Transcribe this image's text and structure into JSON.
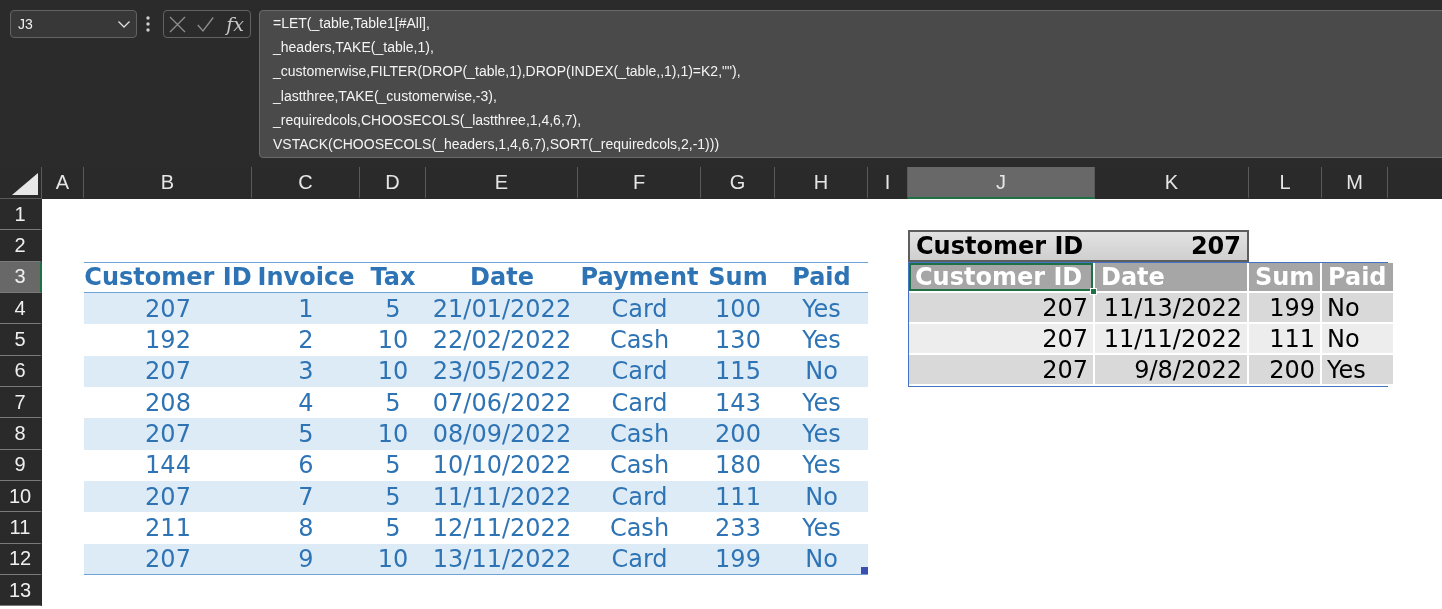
{
  "formula_bar": {
    "name_box": "J3",
    "function_label": "fx",
    "formula_lines": [
      "=LET(_table,Table1[#All],",
      "_headers,TAKE(_table,1),",
      "_customerwise,FILTER(DROP(_table,1),DROP(INDEX(_table,,1),1)=K2,\"\"),",
      "_lastthree,TAKE(_customerwise,-3),",
      "_requiredcols,CHOOSECOLS(_lastthree,1,4,6,7),",
      "VSTACK(CHOOSECOLS(_headers,1,4,6,7),SORT(_requiredcols,2,-1)))"
    ]
  },
  "column_headers": [
    {
      "label": "A",
      "selected": false
    },
    {
      "label": "B",
      "selected": false
    },
    {
      "label": "C",
      "selected": false
    },
    {
      "label": "D",
      "selected": false
    },
    {
      "label": "E",
      "selected": false
    },
    {
      "label": "F",
      "selected": false
    },
    {
      "label": "G",
      "selected": false
    },
    {
      "label": "H",
      "selected": false
    },
    {
      "label": "I",
      "selected": false
    },
    {
      "label": "J",
      "selected": true
    },
    {
      "label": "K",
      "selected": false
    },
    {
      "label": "L",
      "selected": false
    },
    {
      "label": "M",
      "selected": false
    }
  ],
  "row_headers": [
    {
      "label": "1",
      "selected": false
    },
    {
      "label": "2",
      "selected": false
    },
    {
      "label": "3",
      "selected": true
    },
    {
      "label": "4",
      "selected": false
    },
    {
      "label": "5",
      "selected": false
    },
    {
      "label": "6",
      "selected": false
    },
    {
      "label": "7",
      "selected": false
    },
    {
      "label": "8",
      "selected": false
    },
    {
      "label": "9",
      "selected": false
    },
    {
      "label": "10",
      "selected": false
    },
    {
      "label": "11",
      "selected": false
    },
    {
      "label": "12",
      "selected": false
    },
    {
      "label": "13",
      "selected": false
    }
  ],
  "sales_table": {
    "columns": [
      "Customer ID",
      "Invoice",
      "Tax",
      "Date",
      "Payment",
      "Sum",
      "Paid"
    ],
    "rows": [
      [
        "207",
        "1",
        "5",
        "21/01/2022",
        "Card",
        "100",
        "Yes"
      ],
      [
        "192",
        "2",
        "10",
        "22/02/2022",
        "Cash",
        "130",
        "Yes"
      ],
      [
        "207",
        "3",
        "10",
        "23/05/2022",
        "Card",
        "115",
        "No"
      ],
      [
        "208",
        "4",
        "5",
        "07/06/2022",
        "Card",
        "143",
        "Yes"
      ],
      [
        "207",
        "5",
        "10",
        "08/09/2022",
        "Cash",
        "200",
        "Yes"
      ],
      [
        "144",
        "6",
        "5",
        "10/10/2022",
        "Cash",
        "180",
        "Yes"
      ],
      [
        "207",
        "7",
        "5",
        "11/11/2022",
        "Card",
        "111",
        "No"
      ],
      [
        "211",
        "8",
        "5",
        "12/11/2022",
        "Cash",
        "233",
        "Yes"
      ],
      [
        "207",
        "9",
        "10",
        "13/11/2022",
        "Card",
        "199",
        "No"
      ]
    ]
  },
  "lookup": {
    "label": "Customer ID",
    "value": "207"
  },
  "result_table": {
    "columns": [
      "Customer ID",
      "Date",
      "Sum",
      "Paid"
    ],
    "rows": [
      [
        "207",
        "11/13/2022",
        "199",
        "No"
      ],
      [
        "207",
        "11/11/2022",
        "111",
        "No"
      ],
      [
        "207",
        "9/8/2022",
        "200",
        "Yes"
      ]
    ]
  }
}
